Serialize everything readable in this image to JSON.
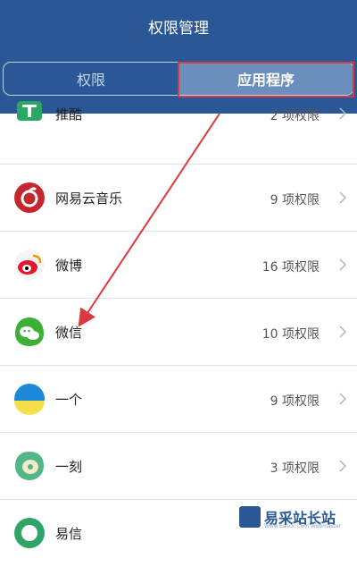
{
  "header": {
    "title": "权限管理",
    "tabs": [
      {
        "label": "权限",
        "selected": false
      },
      {
        "label": "应用程序",
        "selected": true
      }
    ]
  },
  "apps": [
    {
      "name": "推酷",
      "permissions": "2 项权限",
      "icon": "tuicool-icon"
    },
    {
      "name": "网易云音乐",
      "permissions": "9 项权限",
      "icon": "netease-music-icon"
    },
    {
      "name": "微博",
      "permissions": "16 项权限",
      "icon": "weibo-icon"
    },
    {
      "name": "微信",
      "permissions": "10 项权限",
      "icon": "wechat-icon"
    },
    {
      "name": "一个",
      "permissions": "9 项权限",
      "icon": "one-icon"
    },
    {
      "name": "一刻",
      "permissions": "3 项权限",
      "icon": "yike-icon"
    },
    {
      "name": "易信",
      "permissions": "",
      "icon": "yixin-icon"
    }
  ],
  "watermark": {
    "text": "易采站长站",
    "subtext": "Www.Easck.Com Webmaster"
  },
  "colors": {
    "header": "#2a5795",
    "selected_tab": "#6a8fbd",
    "annotation": "#d9393f"
  }
}
